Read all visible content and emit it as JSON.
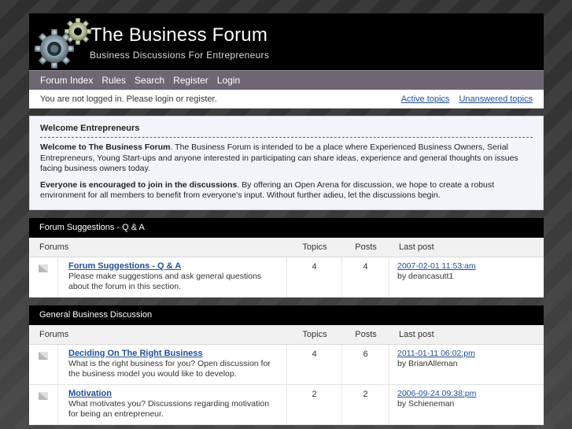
{
  "header": {
    "title": "The Business Forum",
    "subtitle": "Business Discussions For Entrepreneurs"
  },
  "nav": {
    "items": [
      {
        "label": "Forum Index"
      },
      {
        "label": "Rules"
      },
      {
        "label": "Search"
      },
      {
        "label": "Register"
      },
      {
        "label": "Login"
      }
    ]
  },
  "loginbar": {
    "message": "You are not logged in. Please login or register.",
    "active_topics": "Active topics",
    "unanswered_topics": "Unanswered topics"
  },
  "welcome": {
    "heading": "Welcome Entrepreneurs",
    "p1_bold": "Welcome to The Business Forum",
    "p1_text": ". The Business Forum is intended to be a place where Experienced Business Owners, Serial Entrepreneurs, Young Start-ups and anyone interested in participating can share ideas, experience and general thoughts on issues facing business owners today.",
    "p2_bold": "Everyone is encouraged to join in the discussions",
    "p2_text": ". By offering an Open Arena for discussion, we hope to create a robust environment for all members to benefit from everyone's input. Without further adieu, let the discussions begin."
  },
  "columns": {
    "forums": "Forums",
    "topics": "Topics",
    "posts": "Posts",
    "last_post": "Last post"
  },
  "categories": [
    {
      "name": "Forum Suggestions - Q & A",
      "forums": [
        {
          "title": "Forum Suggestions - Q & A",
          "desc": "Please make suggestions and ask general questions about the forum in this section.",
          "topics": "4",
          "posts": "4",
          "last_date": "2007-02-01 11:53:am",
          "last_by": "by deancasutt1"
        }
      ]
    },
    {
      "name": "General Business Discussion",
      "forums": [
        {
          "title": "Deciding On The Right Business",
          "desc": "What is the right business for you? Open discussion for the business model you would like to develop.",
          "topics": "4",
          "posts": "6",
          "last_date": "2011-01-11 06:02:pm",
          "last_by": "by BrianAlleman"
        },
        {
          "title": "Motivation",
          "desc": "What motivates you? Discussions regarding motivation for being an entrepreneur.",
          "topics": "2",
          "posts": "2",
          "last_date": "2006-09-24 09:38:pm",
          "last_by": "by Schieneman"
        }
      ]
    }
  ],
  "colors": {
    "header_bg": "#000000",
    "nav_bg": "#6e6773",
    "link": "#1f4f9b",
    "welcome_bg": "#f1f5f9"
  }
}
